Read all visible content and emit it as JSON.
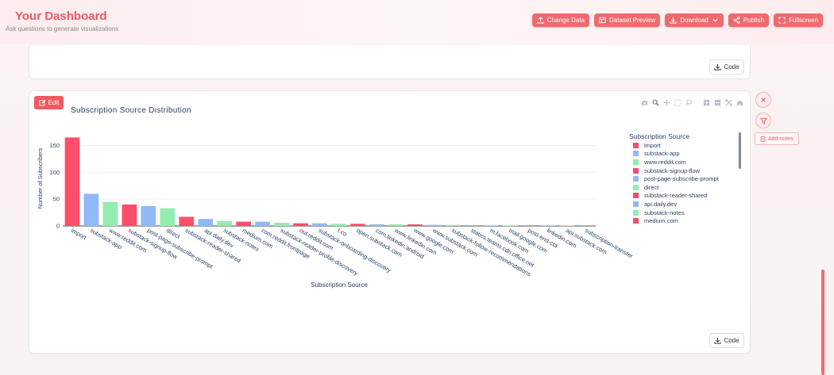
{
  "header": {
    "title": "Your Dashboard",
    "subtitle": "Ask questions to generate visualizations",
    "buttons": [
      {
        "label": "Change Data",
        "icon": "upload-icon"
      },
      {
        "label": "Dataset Preview",
        "icon": "table-icon"
      },
      {
        "label": "Download",
        "icon": "download-icon"
      },
      {
        "label": "Publish",
        "icon": "share-icon"
      },
      {
        "label": "Fullscreen",
        "icon": "expand-icon"
      }
    ]
  },
  "card_top": {
    "code_label": "Code"
  },
  "card_chart": {
    "edit_label": "Edit",
    "code_label": "Code",
    "modebar_icons": [
      "camera-icon",
      "zoom-icon",
      "pan-icon",
      "box-select-icon",
      "lasso-icon",
      "zoom-in-icon",
      "zoom-out-icon",
      "autoscale-icon",
      "home-icon"
    ]
  },
  "side_actions": {
    "add_notes_label": "Add notes"
  },
  "colors": {
    "accent": "#ef5a60",
    "bar_red": "#ff4d6a",
    "bar_blue": "#91b8f7",
    "bar_green": "#93ecb0"
  },
  "chart_data": {
    "type": "bar",
    "title": "Subscription Source Distribution",
    "xlabel": "Subscription Source",
    "ylabel": "Number of Subscribers",
    "ylim": [
      0,
      170
    ],
    "yticks": [
      0,
      50,
      100,
      150
    ],
    "grid": true,
    "legend_title": "Subscription Source",
    "legend_position": "right",
    "categories": [
      "import",
      "substack-app",
      "www.reddit.com",
      "substack-signup-flow",
      "post-page-subscribe-prompt",
      "direct",
      "substack-reader-shared",
      "api.daily.dev",
      "substack-notes",
      "medium.com",
      "com.reddit.frontpage",
      "substack-reader-profile-discovery",
      "out.reddit.com",
      "substack-onboarding-discovery",
      "t.co",
      "open.substack.com",
      "com.linkedin.android",
      "www.linkedin.com",
      "www.google.com",
      "www.substack.com",
      "substack-follow-recommendations",
      "statics.teams.cdn.office.net",
      "m.facebook.com",
      "mail.google.com",
      "post-end-cta",
      "linkedin.com",
      "api.substack.com",
      "subscription-transfer"
    ],
    "values": [
      165,
      60,
      45,
      40,
      37,
      33,
      17,
      13,
      9,
      8,
      8,
      6,
      5,
      5,
      4,
      4,
      3,
      3,
      3,
      2,
      2,
      1,
      1,
      1,
      1,
      1,
      1,
      1
    ],
    "bar_colors": [
      "#ff4d6a",
      "#91b8f7",
      "#93ecb0",
      "#ff4d6a",
      "#91b8f7",
      "#93ecb0",
      "#ff4d6a",
      "#91b8f7",
      "#93ecb0",
      "#ff4d6a",
      "#91b8f7",
      "#93ecb0",
      "#ff4d6a",
      "#91b8f7",
      "#93ecb0",
      "#ff4d6a",
      "#91b8f7",
      "#93ecb0",
      "#ff4d6a",
      "#91b8f7",
      "#93ecb0",
      "#ff4d6a",
      "#91b8f7",
      "#93ecb0",
      "#ff4d6a",
      "#91b8f7",
      "#93ecb0",
      "#ff4d6a"
    ],
    "legend_entries": [
      {
        "name": "import",
        "color": "#ff4d6a"
      },
      {
        "name": "substack-app",
        "color": "#91b8f7"
      },
      {
        "name": "www.reddit.com",
        "color": "#93ecb0"
      },
      {
        "name": "substack-signup-flow",
        "color": "#ff4d6a"
      },
      {
        "name": "post-page-subscribe-prompt",
        "color": "#91b8f7"
      },
      {
        "name": "direct",
        "color": "#93ecb0"
      },
      {
        "name": "substack-reader-shared",
        "color": "#ff4d6a"
      },
      {
        "name": "api.daily.dev",
        "color": "#91b8f7"
      },
      {
        "name": "substack-notes",
        "color": "#93ecb0"
      },
      {
        "name": "medium.com",
        "color": "#ff4d6a"
      }
    ]
  }
}
